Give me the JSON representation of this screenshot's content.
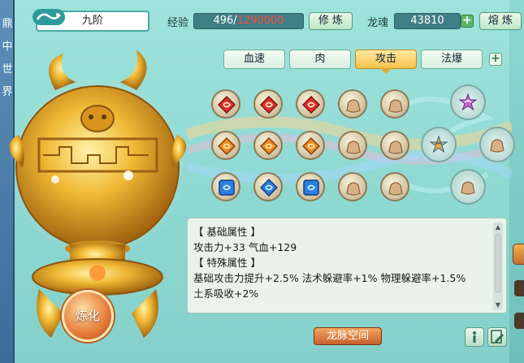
{
  "left_strip": {
    "chars": [
      "鼎",
      "中",
      "世",
      "界"
    ]
  },
  "tier": {
    "label": "九阶"
  },
  "experience": {
    "label": "经验",
    "current": "496",
    "separator": "/",
    "max": "1290000",
    "action_label": "修 炼"
  },
  "dragon_soul": {
    "label": "龙魂",
    "value": "43810",
    "action_label": "熔 炼"
  },
  "tabs": [
    {
      "label": "血速",
      "active": false
    },
    {
      "label": "肉",
      "active": false
    },
    {
      "label": "攻击",
      "active": true
    },
    {
      "label": "法爆",
      "active": false
    }
  ],
  "smelt_button": {
    "label": "炼化"
  },
  "attributes": {
    "basic_header": "【 基础属性 】",
    "basic_line": "攻击力+33  气血+129",
    "special_header": "【 特殊属性 】",
    "special_line_1": "基础攻击力提升+2.5%  法术躲避率+1%  物理躲避率+1.5%",
    "special_line_2": "土系吸收+2%"
  },
  "dragon_space_button": {
    "label": "龙脉空间"
  },
  "colors": {
    "red_gem": "#e0312c",
    "orange_gem": "#f08a1e",
    "blue_gem": "#2c7fe0",
    "accent_gold": "#f5c14a"
  }
}
